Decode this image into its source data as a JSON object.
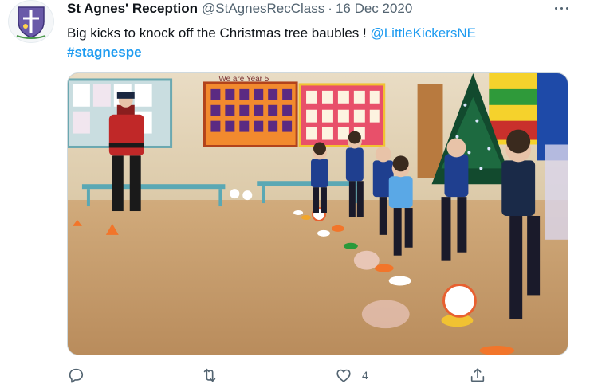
{
  "tweet": {
    "author_name": "St Agnes' Reception",
    "author_handle": "@StAgnesRecClass",
    "separator": "·",
    "date": "16 Dec 2020",
    "text_main": "Big kicks to knock off the Christmas tree baubles ! ",
    "mention": "@LittleKickersNE",
    "hashtag": "#stagnespe",
    "media_sign_text": "We are Year 5"
  },
  "actions": {
    "reply_icon": "reply-icon",
    "retweet_icon": "retweet-icon",
    "like_icon": "heart-icon",
    "like_count": "4",
    "share_icon": "share-icon",
    "more_icon": "more-dots-icon"
  },
  "colors": {
    "link": "#1d9bf0",
    "secondary_text": "#536471",
    "primary_text": "#0f1419"
  }
}
